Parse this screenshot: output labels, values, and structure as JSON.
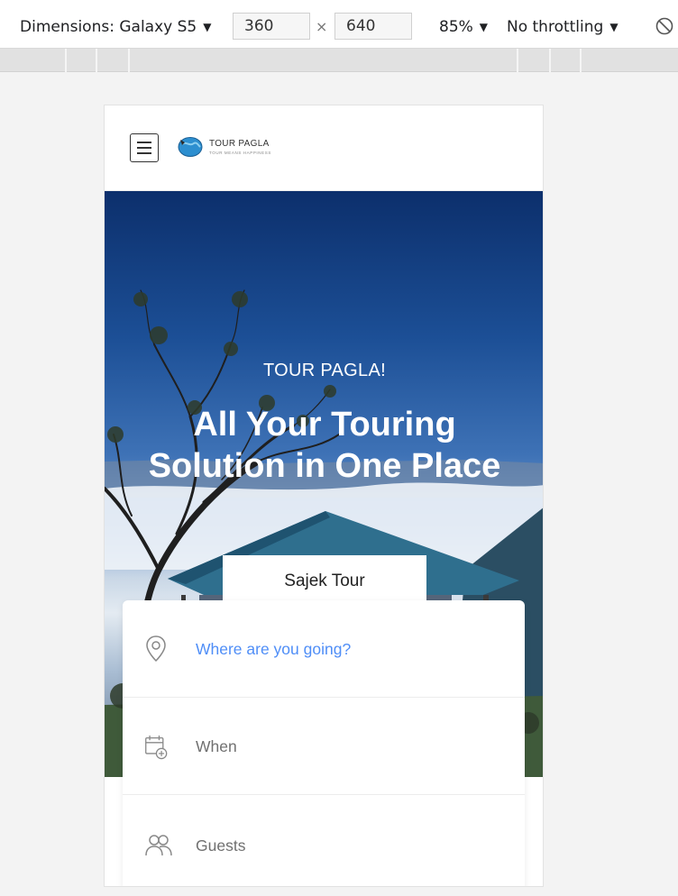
{
  "devtools": {
    "dimensions_label": "Dimensions: Galaxy S5",
    "width": "360",
    "times": "×",
    "height": "640",
    "zoom": "85%",
    "throttling": "No throttling",
    "rotate_icon": "rotate-icon"
  },
  "site": {
    "logo_name": "TOUR PAGLA",
    "logo_tagline": "TOUR MEANS HAPPINESS",
    "menu_icon": "hamburger-menu-icon"
  },
  "hero": {
    "kicker": "TOUR PAGLA!",
    "title": "All Your Touring Solution in One Place",
    "tab_label": "Sajek Tour"
  },
  "search": {
    "destination_placeholder": "Where are you going?",
    "when_label": "When",
    "guests_label": "Guests"
  },
  "colors": {
    "accent": "#4f8ef7",
    "muted_text": "#707070"
  }
}
